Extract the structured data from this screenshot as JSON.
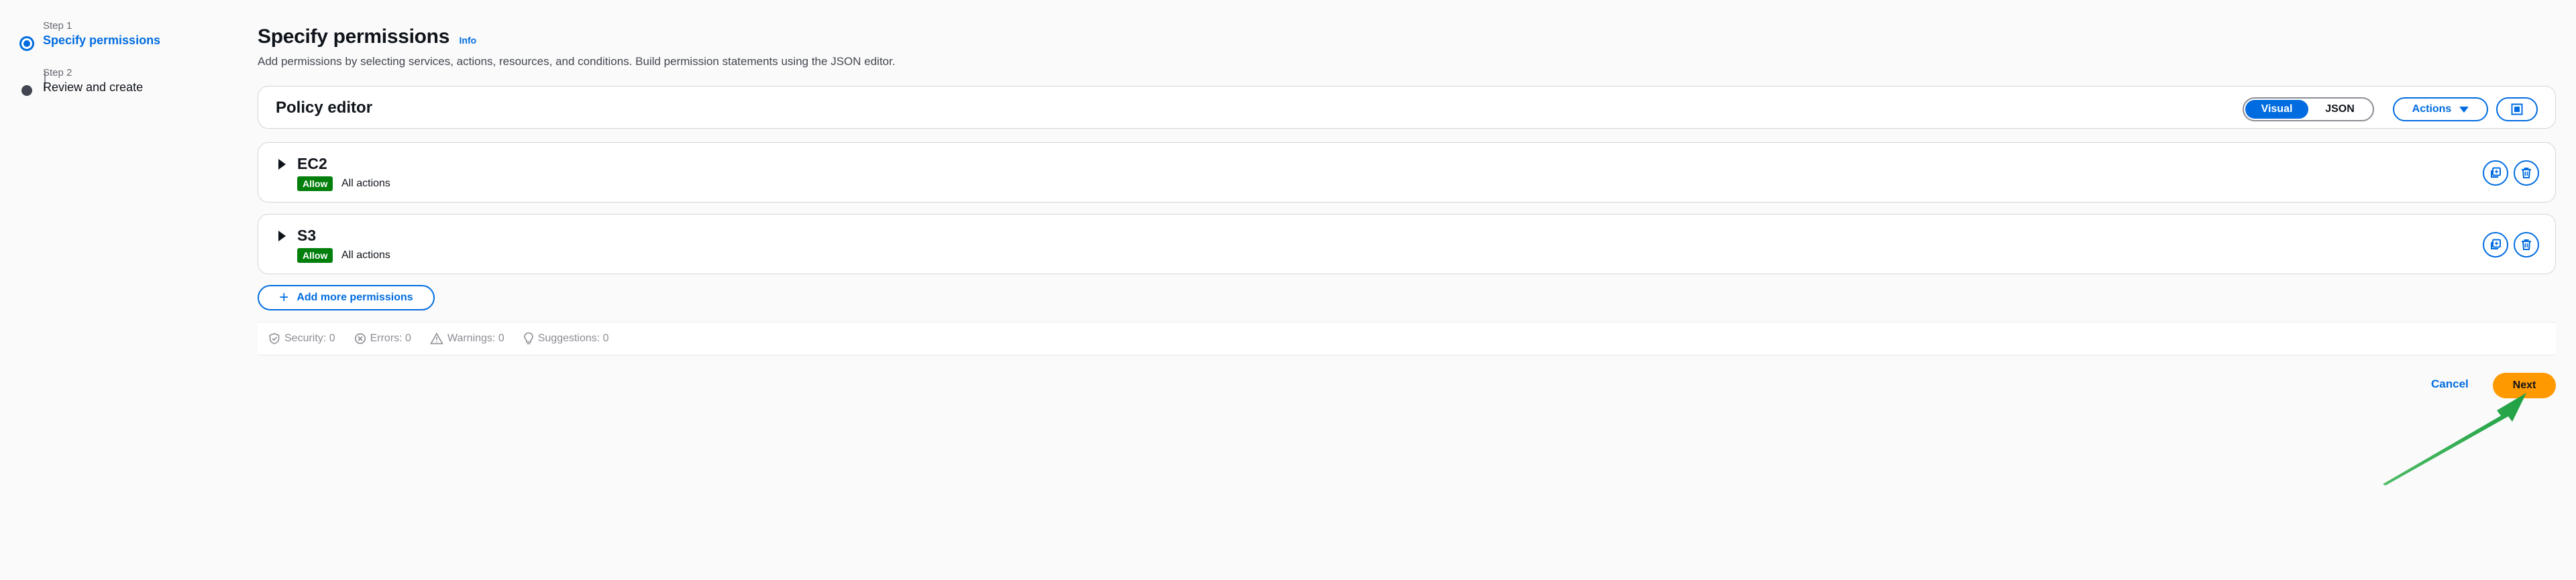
{
  "wizard": {
    "steps": [
      {
        "step_label": "Step 1",
        "title": "Specify permissions",
        "state": "active"
      },
      {
        "step_label": "Step 2",
        "title": "Review and create",
        "state": "inactive"
      }
    ]
  },
  "header": {
    "title": "Specify permissions",
    "info_link": "Info",
    "description": "Add permissions by selecting services, actions, resources, and conditions. Build permission statements using the JSON editor."
  },
  "policy_editor": {
    "title": "Policy editor",
    "mode_options": [
      "Visual",
      "JSON"
    ],
    "selected_mode": "Visual",
    "actions_label": "Actions"
  },
  "services": [
    {
      "name": "EC2",
      "effect": "Allow",
      "actions": "All actions"
    },
    {
      "name": "S3",
      "effect": "Allow",
      "actions": "All actions"
    }
  ],
  "add_permissions_label": "Add more permissions",
  "status": {
    "security": "Security: 0",
    "errors": "Errors: 0",
    "warnings": "Warnings: 0",
    "suggestions": "Suggestions: 0"
  },
  "footer": {
    "cancel_label": "Cancel",
    "next_label": "Next"
  },
  "colors": {
    "accent": "#006ce0",
    "allow_badge": "#037f0c",
    "primary_button": "#ff9900",
    "annotation_arrow": "#2db04a"
  }
}
